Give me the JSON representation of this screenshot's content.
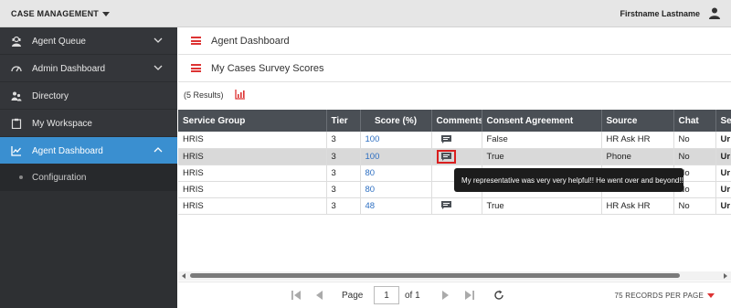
{
  "header": {
    "app_title": "CASE MANAGEMENT",
    "user_name": "Firstname Lastname"
  },
  "sidebar": {
    "items": [
      {
        "label": "Agent Queue",
        "icon": "headset-icon",
        "has_chevron": true
      },
      {
        "label": "Admin Dashboard",
        "icon": "gauge-icon",
        "has_chevron": true
      },
      {
        "label": "Directory",
        "icon": "people-icon",
        "has_chevron": false
      },
      {
        "label": "My Workspace",
        "icon": "clipboard-icon",
        "has_chevron": false
      },
      {
        "label": "Agent Dashboard",
        "icon": "chart-icon",
        "has_chevron": true,
        "active": true
      }
    ],
    "sub_item": {
      "label": "Configuration"
    }
  },
  "panels": {
    "agent_dashboard": "Agent Dashboard",
    "survey_scores": "My Cases Survey Scores"
  },
  "results_label": "(5 Results)",
  "table": {
    "columns": [
      "Service Group",
      "Tier",
      "Score (%)",
      "Comments",
      "Consent Agreement",
      "Source",
      "Chat",
      "Se"
    ],
    "rows": [
      {
        "service_group": "HRIS",
        "tier": "3",
        "score": "100",
        "has_comment": true,
        "consent": "False",
        "source": "HR Ask HR",
        "chat": "No",
        "se": "Ur"
      },
      {
        "service_group": "HRIS",
        "tier": "3",
        "score": "100",
        "has_comment": true,
        "consent": "True",
        "source": "Phone",
        "chat": "No",
        "se": "Ur",
        "selected": true
      },
      {
        "service_group": "HRIS",
        "tier": "3",
        "score": "80",
        "has_comment": false,
        "consent": "",
        "source": "",
        "chat": "No",
        "se": "Ur"
      },
      {
        "service_group": "HRIS",
        "tier": "3",
        "score": "80",
        "has_comment": false,
        "consent": "",
        "source": "",
        "chat": "No",
        "se": "Ur"
      },
      {
        "service_group": "HRIS",
        "tier": "3",
        "score": "48",
        "has_comment": true,
        "consent": "True",
        "source": "HR Ask HR",
        "chat": "No",
        "se": "Ur"
      }
    ]
  },
  "tooltip": "My representative was very very helpful!! He went over and beyond!!",
  "pager": {
    "page_label": "Page",
    "current_page": "1",
    "of_label": "of 1",
    "records_per_page": "75 RECORDS PER PAGE"
  },
  "colors": {
    "accent": "#3a8fd0",
    "sidebar_bg": "#34363a",
    "table_header": "#4a4f55",
    "highlight_red": "#d91f1f",
    "link_blue": "#2d6fc2"
  }
}
